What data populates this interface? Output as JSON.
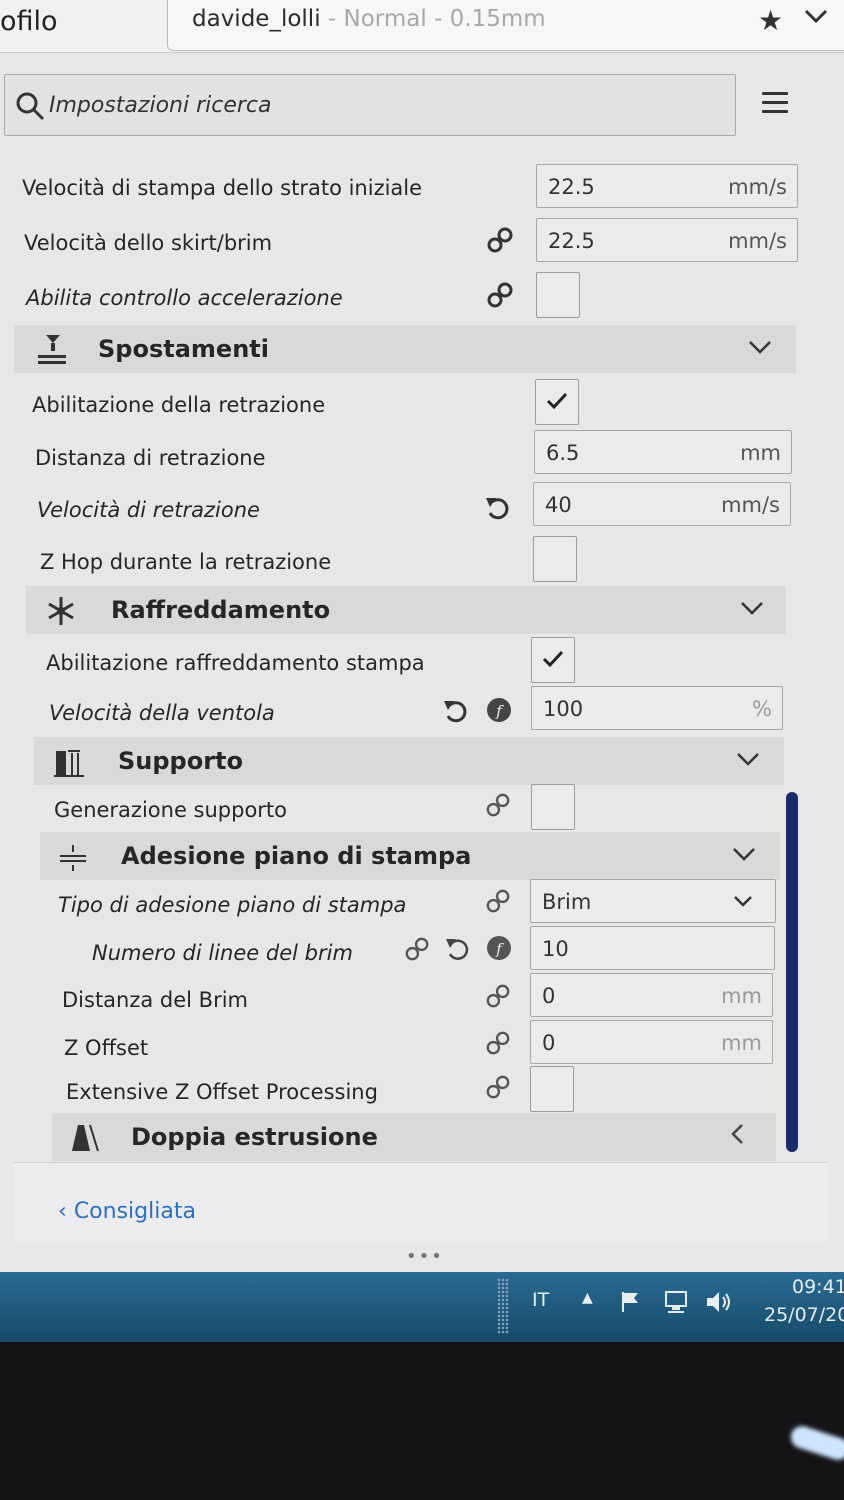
{
  "header": {
    "tab_label": "ofilo",
    "profile_name": "davide_lolli",
    "profile_suffix": " - Normal - 0.15mm"
  },
  "search": {
    "placeholder": "Impostazioni ricerca"
  },
  "settings": {
    "initial_layer_speed": {
      "label": "Velocità di stampa dello strato iniziale",
      "value": "22.5",
      "unit": "mm/s"
    },
    "skirt_brim_speed": {
      "label": "Velocità dello skirt/brim",
      "value": "22.5",
      "unit": "mm/s"
    },
    "acceleration_control": {
      "label": "Abilita controllo accelerazione",
      "checked": false
    },
    "retraction_enable": {
      "label": "Abilitazione della retrazione",
      "checked": true
    },
    "retraction_distance": {
      "label": "Distanza di retrazione",
      "value": "6.5",
      "unit": "mm"
    },
    "retraction_speed": {
      "label": "Velocità di retrazione",
      "value": "40",
      "unit": "mm/s"
    },
    "z_hop": {
      "label": "Z Hop durante la retrazione",
      "checked": false
    },
    "cooling_enable": {
      "label": "Abilitazione raffreddamento stampa",
      "checked": true
    },
    "fan_speed": {
      "label": "Velocità della ventola",
      "value": "100",
      "unit": "%"
    },
    "support_generation": {
      "label": "Generazione supporto",
      "checked": false
    },
    "adhesion_type": {
      "label": "Tipo di adesione piano di stampa",
      "value": "Brim"
    },
    "brim_line_count": {
      "label": "Numero di linee del brim",
      "value": "10"
    },
    "brim_distance": {
      "label": "Distanza del Brim",
      "value": "0",
      "unit": "mm"
    },
    "z_offset": {
      "label": "Z Offset",
      "value": "0",
      "unit": "mm"
    },
    "extensive_z_offset": {
      "label": "Extensive Z Offset Processing",
      "checked": false
    }
  },
  "categories": {
    "travel": "Spostamenti",
    "cooling": "Raffreddamento",
    "support": "Supporto",
    "adhesion": "Adesione piano di stampa",
    "dual": "Doppia estrusione"
  },
  "footer": {
    "back_label": "Consigliata"
  },
  "taskbar": {
    "language": "IT",
    "time": "09:41",
    "date": "25/07/20"
  }
}
